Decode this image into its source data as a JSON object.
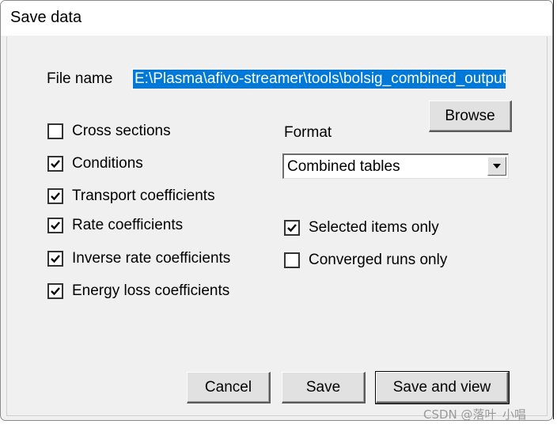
{
  "dialog": {
    "title": "Save data",
    "file_name_label": "File name",
    "file_name_value": "E:\\Plasma\\afivo-streamer\\tools\\bolsig_combined_output",
    "browse_label": "Browse",
    "format_label": "Format",
    "format_value": "Combined tables",
    "left_options": [
      {
        "label": "Cross sections",
        "checked": false
      },
      {
        "label": "Conditions",
        "checked": true
      },
      {
        "label": "Transport coefficients",
        "checked": true
      },
      {
        "label": "Rate coefficients",
        "checked": true
      },
      {
        "label": "Inverse rate coefficients",
        "checked": true
      },
      {
        "label": "Energy loss coefficients",
        "checked": true
      }
    ],
    "right_options": [
      {
        "label": "Selected items only",
        "checked": true
      },
      {
        "label": "Converged runs only",
        "checked": false
      }
    ],
    "buttons": {
      "cancel": "Cancel",
      "save": "Save",
      "save_and_view": "Save and view"
    }
  },
  "watermark": "CSDN @落叶_小唱",
  "icons": {
    "checkbox_checked": "checkmark-icon",
    "combo_arrow": "chevron-down-icon"
  }
}
